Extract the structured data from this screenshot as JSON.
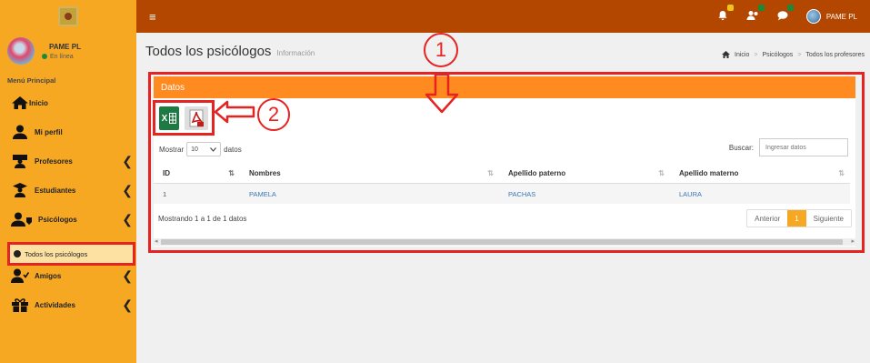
{
  "navbar": {
    "hamburger": "≡",
    "user": "PAME PL",
    "badge_colors": [
      "#f0c419",
      "#1a8a3a",
      "#1a8a3a"
    ]
  },
  "sidebar": {
    "user_name": "PAME PL",
    "status": "En línea",
    "menu_header": "Menú Principal",
    "items": [
      {
        "label": "Inicio",
        "icon": "home-icon"
      },
      {
        "label": "Mi perfil",
        "icon": "user-icon"
      },
      {
        "label": "Profesores",
        "icon": "professor-icon"
      },
      {
        "label": "Estudiantes",
        "icon": "student-icon"
      },
      {
        "label": "Psicólogos",
        "icon": "psychologist-icon"
      },
      {
        "label": "Amigos",
        "icon": "friends-icon"
      },
      {
        "label": "Actividades",
        "icon": "gift-icon"
      }
    ],
    "sub_item": "Todos los psicólogos"
  },
  "page": {
    "title": "Todos los psicólogos",
    "subtitle": "Información",
    "breadcrumb": [
      "Inicio",
      "Psicólogos",
      "Todos los profesores"
    ]
  },
  "panel": {
    "header": "Datos",
    "excel_label": "X",
    "annotation_1": "1",
    "annotation_2": "2"
  },
  "controls": {
    "show_label": "Mostrar",
    "length_value": "10",
    "records_label": "datos",
    "search_label": "Buscar:",
    "search_placeholder": "Ingresar datos"
  },
  "table": {
    "columns": [
      "ID",
      "Nombres",
      "Apellido paterno",
      "Apellido materno"
    ],
    "rows": [
      [
        "1",
        "PAMELA",
        "PACHAS",
        "LAURA"
      ]
    ]
  },
  "footer": {
    "info": "Mostrando 1 a 1 de 1 datos",
    "prev": "Anterior",
    "page": "1",
    "next": "Siguiente"
  },
  "colors": {
    "sidebar": "#f7a823",
    "navbar": "#b34700",
    "panel_header": "#ff8a1f",
    "annotation": "#e52321"
  }
}
